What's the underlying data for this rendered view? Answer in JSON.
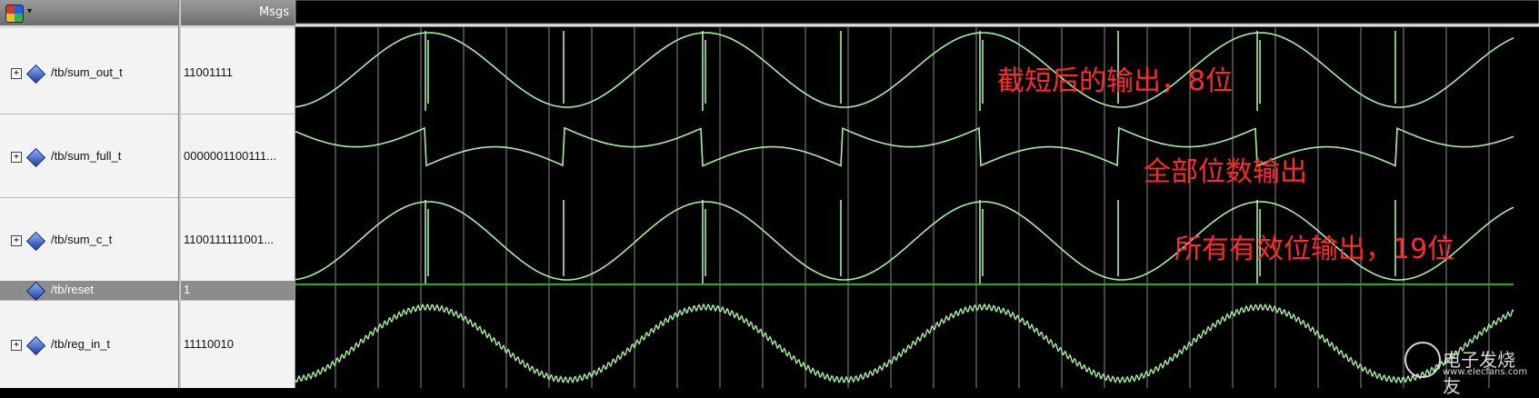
{
  "header": {
    "msgs_label": "Msgs"
  },
  "signals": [
    {
      "name": "/tb/sum_out_t",
      "value": "11001111",
      "expandable": true
    },
    {
      "name": "/tb/sum_full_t",
      "value": "0000001100111...",
      "expandable": true
    },
    {
      "name": "/tb/sum_c_t",
      "value": "1100111111001...",
      "expandable": true
    },
    {
      "name": "/tb/reset",
      "value": "1",
      "expandable": false
    },
    {
      "name": "/tb/reg_in_t",
      "value": "11110010",
      "expandable": true
    }
  ],
  "annotations": {
    "sum_out": "截短后的输出，8位",
    "sum_full": "全部位数输出",
    "sum_c": "所有有效位输出，19位"
  },
  "watermark": {
    "brand": "电子发烧友",
    "url": "www.elecfans.com"
  },
  "colors": {
    "wave": "#a8f0a0",
    "reset_line": "#20b020",
    "cursor_lines": "#9a9a9a",
    "annotation": "#ff2b2b",
    "background": "#000000"
  },
  "icons": {
    "menu": "waveform-menu-icon",
    "signal": "signal-diamond-icon",
    "expand": "plus-expander-icon"
  }
}
